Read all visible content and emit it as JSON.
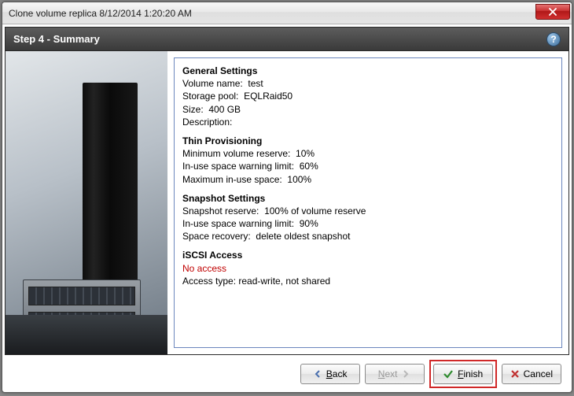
{
  "window": {
    "title": "Clone volume replica 8/12/2014 1:20:20 AM"
  },
  "header": {
    "step_title": "Step 4 - Summary"
  },
  "summary": {
    "general": {
      "heading": "General Settings",
      "volume_name_label": "Volume name:",
      "volume_name_value": "test",
      "storage_pool_label": "Storage pool:",
      "storage_pool_value": "EQLRaid50",
      "size_label": "Size:",
      "size_value": "400 GB",
      "description_label": "Description:",
      "description_value": ""
    },
    "thin": {
      "heading": "Thin Provisioning",
      "min_reserve_label": "Minimum volume reserve:",
      "min_reserve_value": "10%",
      "inuse_warn_label": "In-use space warning limit:",
      "inuse_warn_value": "60%",
      "max_inuse_label": "Maximum in-use space:",
      "max_inuse_value": "100%"
    },
    "snapshot": {
      "heading": "Snapshot Settings",
      "reserve_label": "Snapshot reserve:",
      "reserve_value": "100% of volume reserve",
      "inuse_warn_label": "In-use space warning limit:",
      "inuse_warn_value": "90%",
      "recovery_label": "Space recovery:",
      "recovery_value": "delete oldest snapshot"
    },
    "iscsi": {
      "heading": "iSCSI Access",
      "no_access": "No access",
      "access_type_label": "Access type:",
      "access_type_value": "read-write, not shared"
    }
  },
  "buttons": {
    "back": "Back",
    "next": "Next",
    "finish": "Finish",
    "cancel": "Cancel"
  }
}
